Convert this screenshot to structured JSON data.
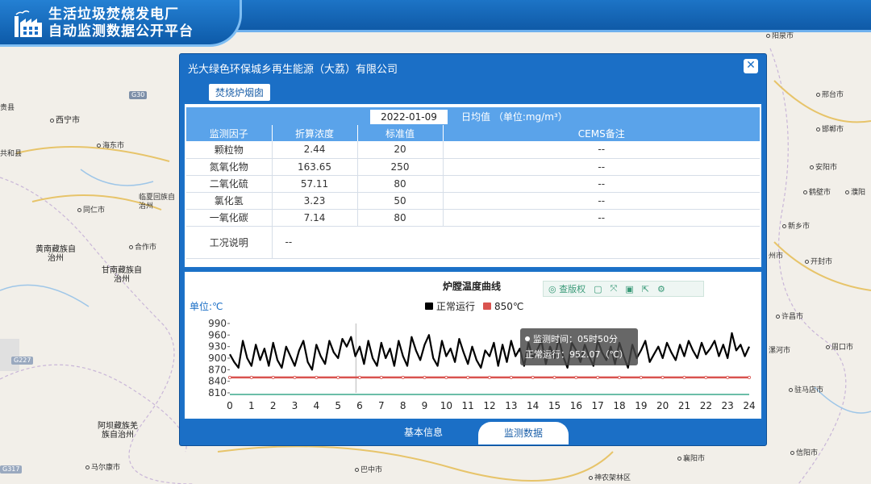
{
  "banner": {
    "title_line1": "生活垃圾焚烧发电厂",
    "title_line2": "自动监测数据公开平台"
  },
  "map": {
    "labels": [
      {
        "text": "西宁市",
        "big": true
      },
      {
        "text": "海东市"
      },
      {
        "text": "临夏回族自治州"
      },
      {
        "text": "同仁市"
      },
      {
        "text": "合作市"
      },
      {
        "text": "黄南藏族自治州",
        "big": true
      },
      {
        "text": "甘南藏族自治州",
        "big": true
      },
      {
        "text": "阿坝藏族羌族自治州",
        "big": true
      },
      {
        "text": "马尔康市"
      },
      {
        "text": "巴中市"
      },
      {
        "text": "阳泉市"
      },
      {
        "text": "邢台市"
      },
      {
        "text": "邯郸市"
      },
      {
        "text": "安阳市"
      },
      {
        "text": "鹤壁市"
      },
      {
        "text": "濮阳"
      },
      {
        "text": "新乡市"
      },
      {
        "text": "开封市"
      },
      {
        "text": "许昌市"
      },
      {
        "text": "周口市"
      },
      {
        "text": "驻马店市"
      },
      {
        "text": "信阳市"
      },
      {
        "text": "襄阳市"
      },
      {
        "text": "神农架林区"
      },
      {
        "text": "漯河市"
      },
      {
        "text": "共和县"
      },
      {
        "text": "贵县"
      },
      {
        "text": "州市"
      }
    ],
    "roads": [
      "G30",
      "G227",
      "G317"
    ]
  },
  "dialog": {
    "title": "光大绿色环保城乡再生能源（大荔）有限公司",
    "close_label": "✕",
    "sub_tab": "焚烧炉烟囱",
    "date": "2022-01-09",
    "daily_label": "日均值 （单位:mg/m³）",
    "table": {
      "headers": [
        "监测因子",
        "折算浓度",
        "标准值",
        "CEMS备注"
      ],
      "rows": [
        [
          "颗粒物",
          "2.44",
          "20",
          "--"
        ],
        [
          "氮氧化物",
          "163.65",
          "250",
          "--"
        ],
        [
          "二氧化硫",
          "57.11",
          "80",
          "--"
        ],
        [
          "氯化氢",
          "3.23",
          "50",
          "--"
        ],
        [
          "一氧化碳",
          "7.14",
          "80",
          "--"
        ]
      ],
      "note_label": "工况说明",
      "note_value": "--"
    },
    "bottom_tabs": {
      "info": "基本信息",
      "monitor": "监测数据"
    }
  },
  "chart_data": {
    "type": "line",
    "title": "炉膛温度曲线",
    "unit_label": "单位:℃",
    "legend": [
      "正常运行",
      "850℃"
    ],
    "toolbox": [
      "查版权"
    ],
    "x_ticks": [
      "0",
      "1",
      "2",
      "3",
      "4",
      "5",
      "6",
      "7",
      "8",
      "9",
      "10",
      "11",
      "12",
      "13",
      "14",
      "15",
      "16",
      "17",
      "18",
      "19",
      "20",
      "21",
      "22",
      "23",
      "24"
    ],
    "y_ticks": [
      "990",
      "960",
      "930",
      "900",
      "870",
      "840",
      "810"
    ],
    "ylim": [
      810,
      990
    ],
    "xlim": [
      0,
      24
    ],
    "colors": {
      "normal": "#000000",
      "threshold": "#d9534f"
    },
    "threshold": 850,
    "series": [
      {
        "name": "正常运行",
        "x": [
          0,
          0.2,
          0.4,
          0.6,
          0.8,
          1.0,
          1.2,
          1.4,
          1.6,
          1.8,
          2.0,
          2.2,
          2.4,
          2.6,
          2.8,
          3.0,
          3.2,
          3.4,
          3.6,
          3.8,
          4.0,
          4.2,
          4.4,
          4.6,
          4.8,
          5.0,
          5.2,
          5.4,
          5.6,
          5.8,
          6.0,
          6.2,
          6.4,
          6.6,
          6.8,
          7.0,
          7.2,
          7.4,
          7.6,
          7.8,
          8.0,
          8.2,
          8.4,
          8.6,
          8.8,
          9.0,
          9.2,
          9.4,
          9.6,
          9.8,
          10.0,
          10.2,
          10.4,
          10.6,
          10.8,
          11.0,
          11.2,
          11.4,
          11.6,
          11.8,
          12.0,
          12.2,
          12.4,
          12.6,
          12.8,
          13.0,
          13.2,
          13.4,
          13.6,
          13.8,
          14.0,
          14.2,
          14.4,
          14.6,
          14.8,
          15.0,
          15.2,
          15.4,
          15.6,
          15.8,
          16.0,
          16.2,
          16.4,
          16.6,
          16.8,
          17.0,
          17.2,
          17.4,
          17.6,
          17.8,
          18.0,
          18.2,
          18.4,
          18.6,
          18.8,
          19.0,
          19.2,
          19.4,
          19.6,
          19.8,
          20.0,
          20.2,
          20.4,
          20.6,
          20.8,
          21.0,
          21.2,
          21.4,
          21.6,
          21.8,
          22.0,
          22.2,
          22.4,
          22.6,
          22.8,
          23.0,
          23.2,
          23.4,
          23.6,
          23.8,
          24.0
        ],
        "values": [
          910,
          890,
          875,
          945,
          900,
          880,
          935,
          895,
          925,
          880,
          940,
          895,
          875,
          930,
          905,
          880,
          920,
          945,
          890,
          870,
          935,
          905,
          885,
          945,
          915,
          900,
          950,
          930,
          955,
          905,
          930,
          885,
          945,
          900,
          880,
          940,
          900,
          925,
          880,
          945,
          905,
          880,
          955,
          920,
          895,
          935,
          960,
          900,
          880,
          945,
          905,
          925,
          890,
          950,
          915,
          885,
          930,
          895,
          875,
          920,
          905,
          940,
          880,
          935,
          890,
          945,
          905,
          925,
          880,
          940,
          900,
          920,
          945,
          885,
          930,
          900,
          950,
          905,
          875,
          940,
          920,
          890,
          935,
          905,
          880,
          945,
          915,
          895,
          930,
          885,
          940,
          905,
          875,
          935,
          900,
          920,
          945,
          890,
          910,
          930,
          900,
          940,
          915,
          895,
          935,
          905,
          945,
          920,
          900,
          940,
          910,
          925,
          945,
          905,
          935,
          900,
          965,
          920,
          935,
          905,
          930
        ]
      },
      {
        "name": "850℃",
        "values": [
          850
        ]
      }
    ],
    "tooltip": {
      "line1": "监测时间：05时50分",
      "line2": "正常运行：952.07（℃）"
    }
  }
}
